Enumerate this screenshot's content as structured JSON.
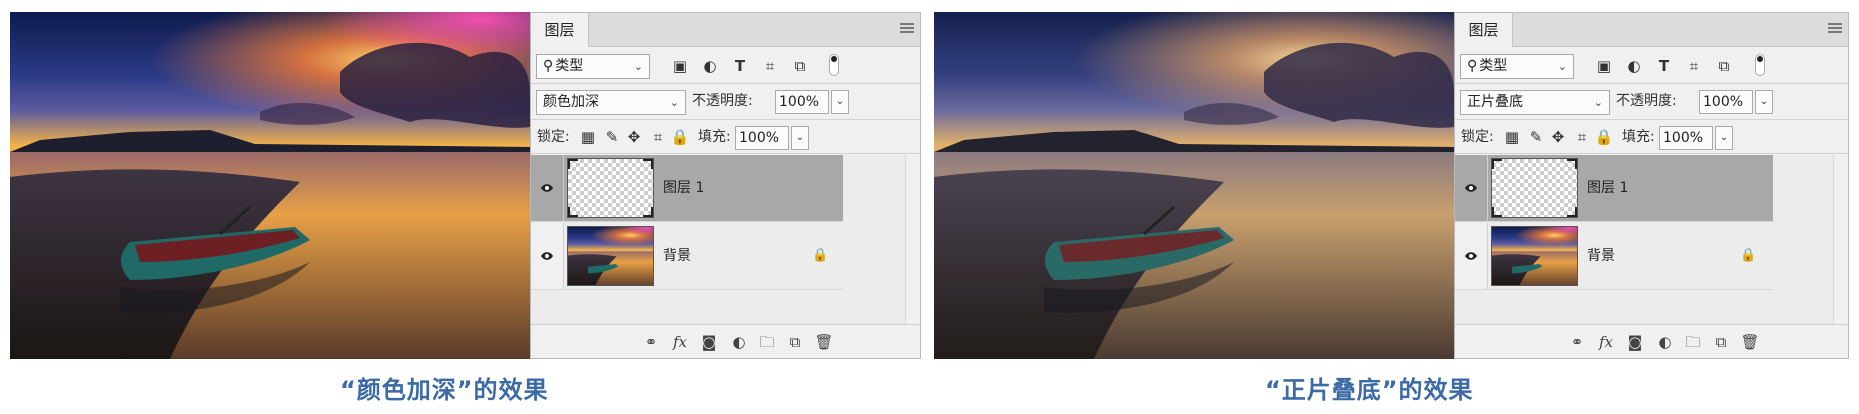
{
  "colors": {
    "caption": "#3b6aa6",
    "selected_layer": "#a8a8a8",
    "panel_bg": "#f0f0f0"
  },
  "left": {
    "panel": {
      "tab": "图层",
      "filter": {
        "label": "类型",
        "icon": "search-icon"
      },
      "filter_icons": [
        "image-filter-icon",
        "adjustment-filter-icon",
        "type-filter-icon",
        "shape-filter-icon",
        "smart-object-filter-icon"
      ],
      "blend_mode": "颜色加深",
      "opacity_label": "不透明度:",
      "opacity": "100%",
      "lock_label": "锁定:",
      "fill_label": "填充:",
      "fill": "100%",
      "layers": [
        {
          "name": "图层 1",
          "selected": true,
          "thumbnail": "transparent"
        },
        {
          "name": "背景",
          "selected": false,
          "thumbnail": "photo",
          "locked": true
        }
      ]
    },
    "caption": "“颜色加深”的效果"
  },
  "right": {
    "panel": {
      "tab": "图层",
      "filter": {
        "label": "类型",
        "icon": "search-icon"
      },
      "filter_icons": [
        "image-filter-icon",
        "adjustment-filter-icon",
        "type-filter-icon",
        "shape-filter-icon",
        "smart-object-filter-icon"
      ],
      "blend_mode": "正片叠底",
      "opacity_label": "不透明度:",
      "opacity": "100%",
      "lock_label": "锁定:",
      "fill_label": "填充:",
      "fill": "100%",
      "layers": [
        {
          "name": "图层 1",
          "selected": true,
          "thumbnail": "transparent"
        },
        {
          "name": "背景",
          "selected": false,
          "thumbnail": "photo",
          "locked": true
        }
      ]
    },
    "caption": "“正片叠底”的效果"
  },
  "footer_icons": [
    "link-layers-icon",
    "fx-icon",
    "add-mask-icon",
    "adjustment-layer-icon",
    "new-group-icon",
    "new-layer-icon",
    "delete-layer-icon"
  ],
  "footer_fx_label": "fx"
}
